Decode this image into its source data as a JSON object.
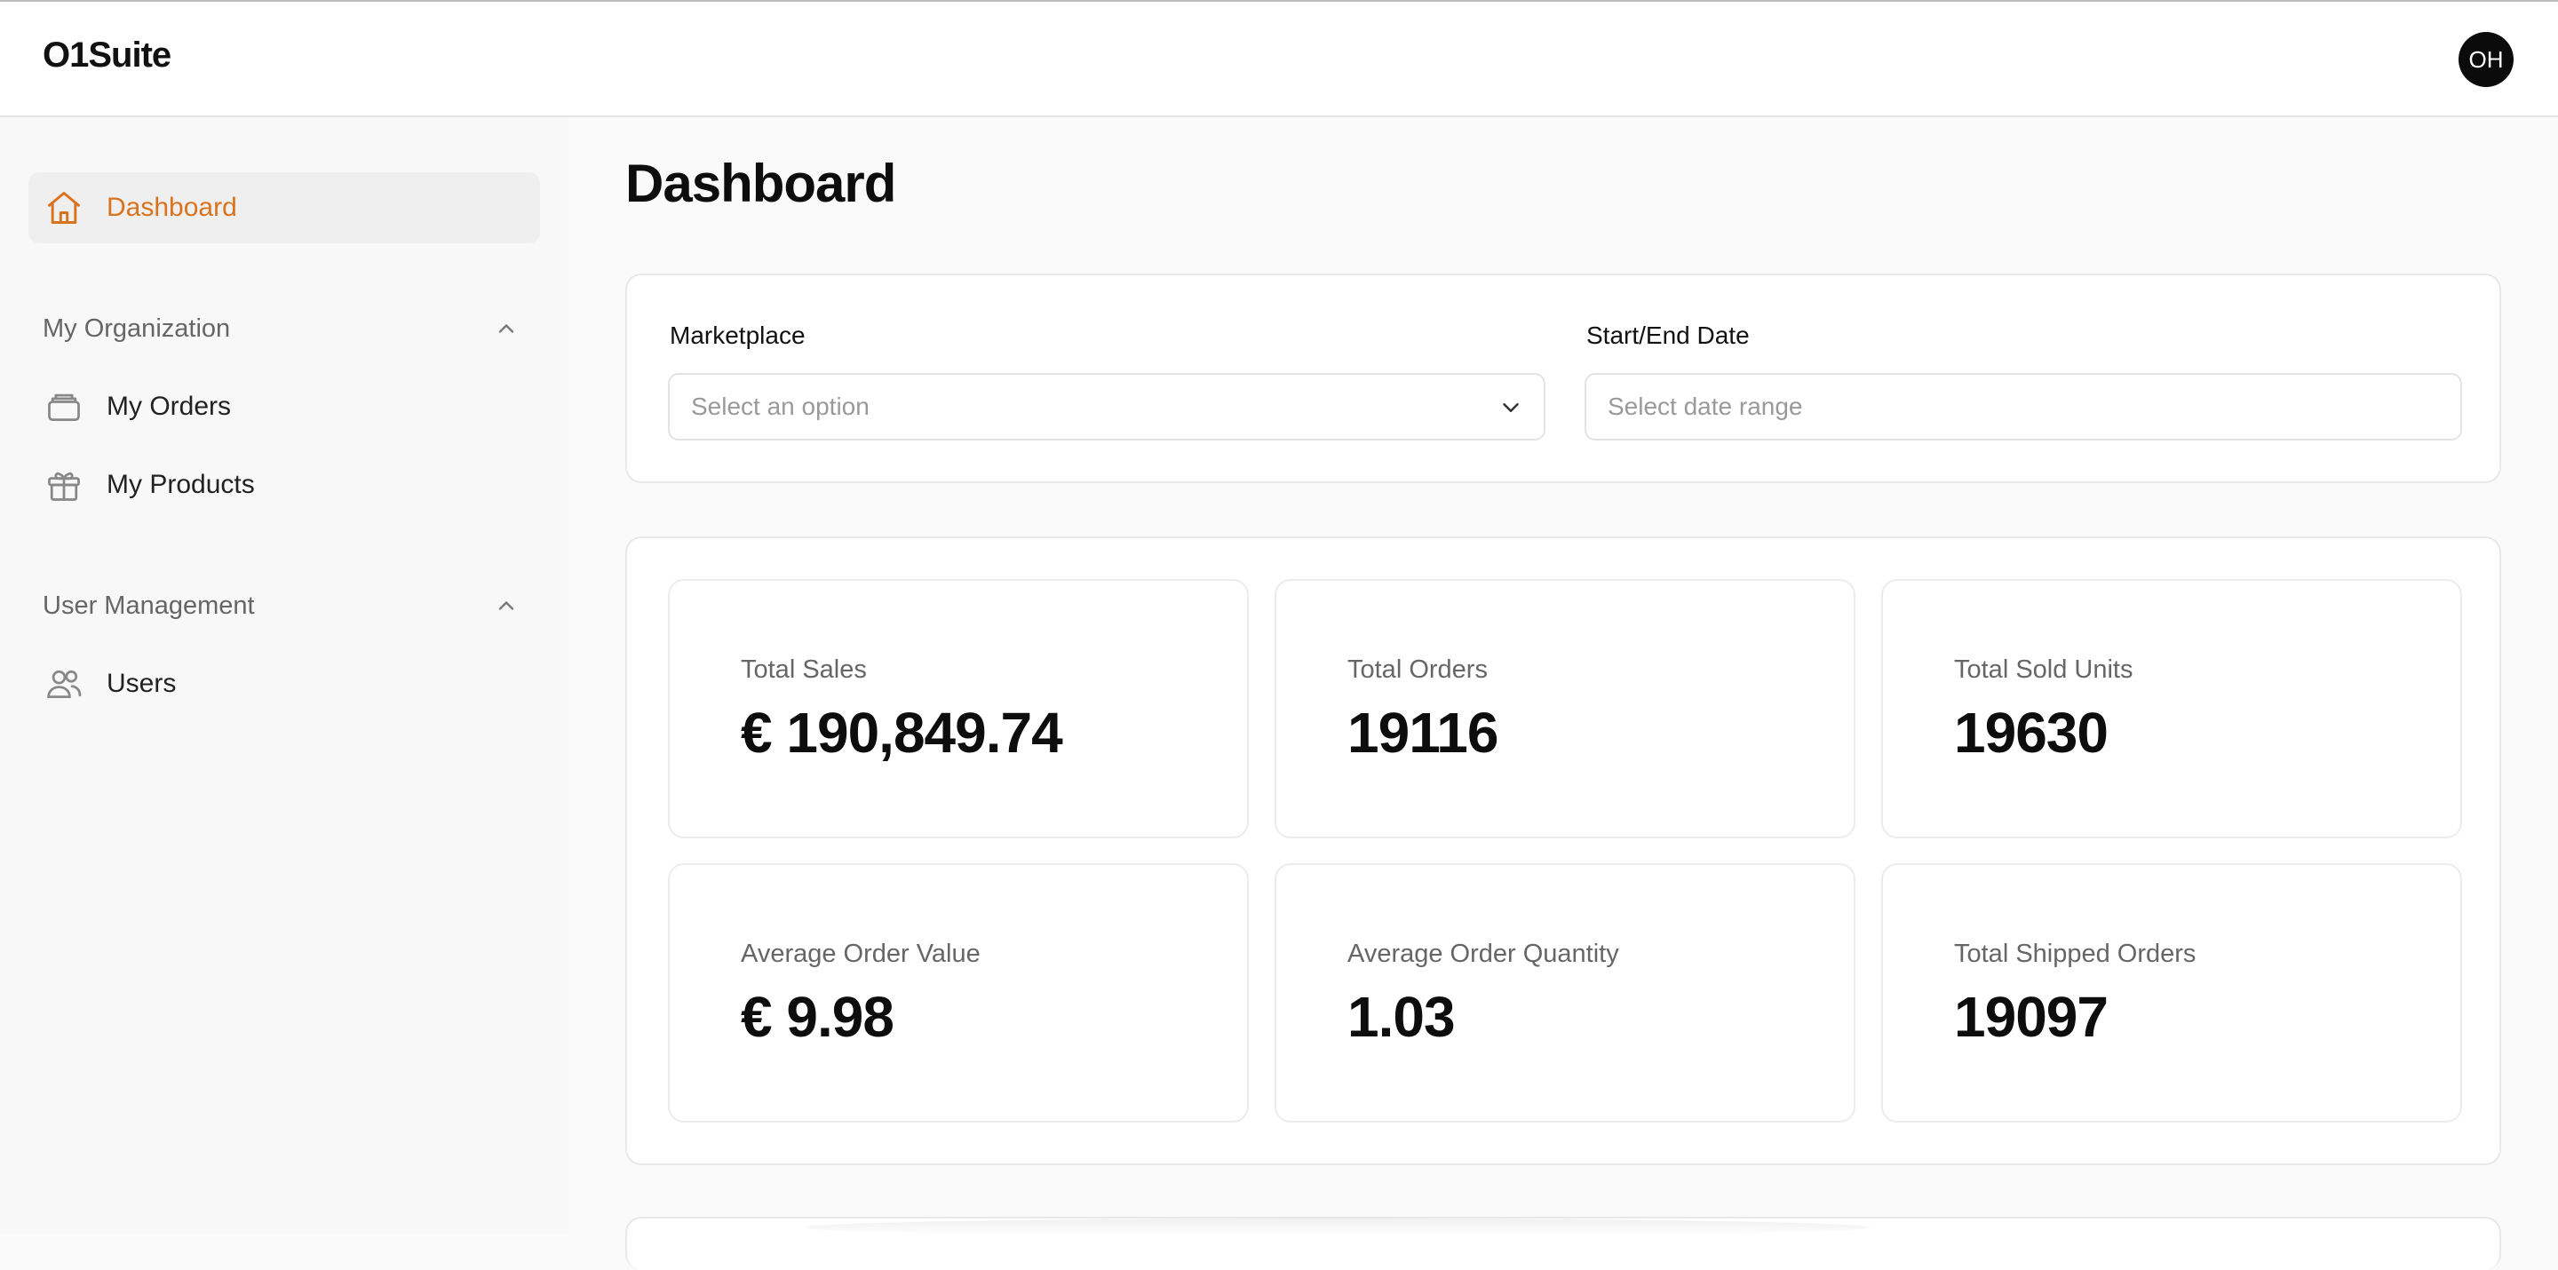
{
  "header": {
    "brand": "O1Suite",
    "avatar_initials": "OH"
  },
  "sidebar": {
    "dashboard": {
      "label": "Dashboard",
      "icon": "home-icon",
      "active": true
    },
    "sections": [
      {
        "title": "My Organization",
        "expanded": true,
        "items": [
          {
            "label": "My Orders",
            "icon": "archive-icon"
          },
          {
            "label": "My Products",
            "icon": "gift-icon"
          }
        ]
      },
      {
        "title": "User Management",
        "expanded": true,
        "items": [
          {
            "label": "Users",
            "icon": "users-icon"
          }
        ]
      }
    ]
  },
  "main": {
    "title": "Dashboard",
    "filters": {
      "marketplace": {
        "label": "Marketplace",
        "placeholder": "Select an option"
      },
      "date": {
        "label": "Start/End Date",
        "placeholder": "Select date range"
      }
    },
    "stats": [
      {
        "label": "Total Sales",
        "value": "€ 190,849.74"
      },
      {
        "label": "Total Orders",
        "value": "19116"
      },
      {
        "label": "Total Sold Units",
        "value": "19630"
      },
      {
        "label": "Average Order Value",
        "value": "€ 9.98"
      },
      {
        "label": "Average Order Quantity",
        "value": "1.03"
      },
      {
        "label": "Total Shipped Orders",
        "value": "19097"
      }
    ]
  },
  "colors": {
    "accent": "#d9731e",
    "background": "#fafafa",
    "card": "#ffffff",
    "muted_text": "#666666"
  }
}
